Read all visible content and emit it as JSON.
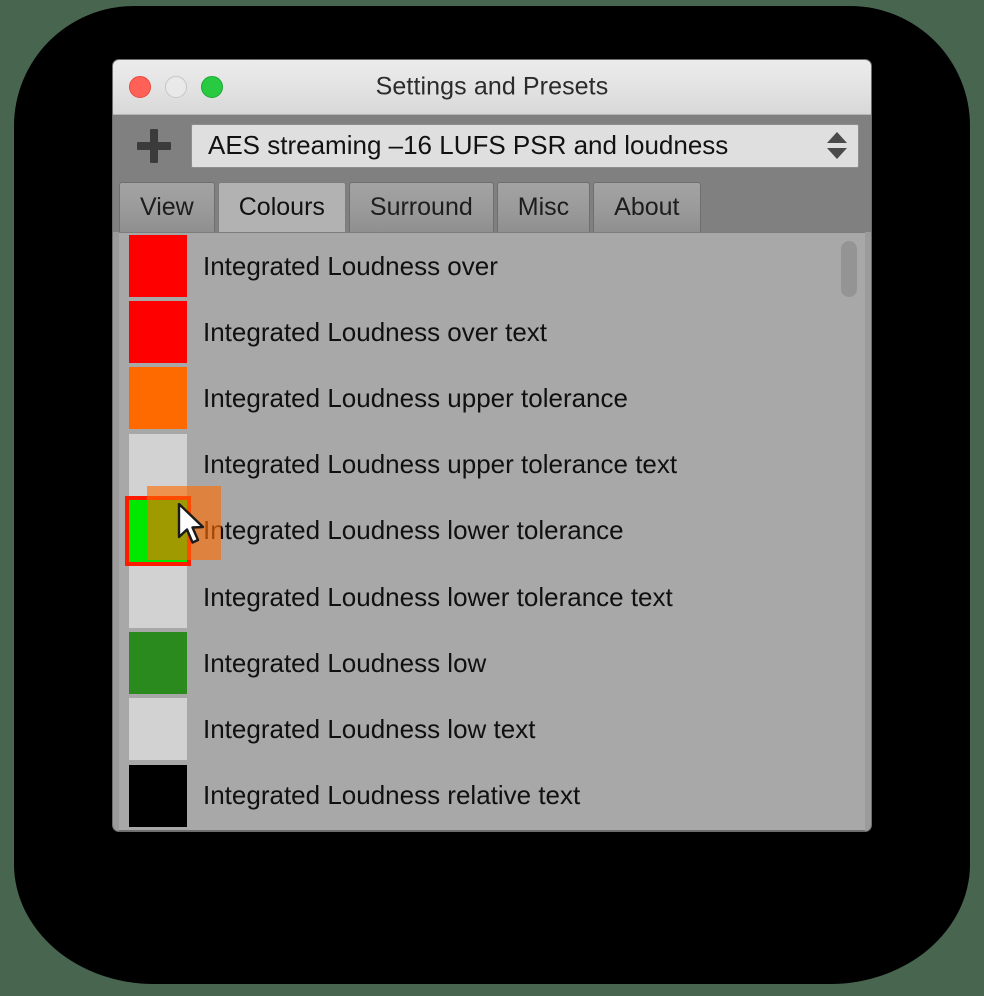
{
  "window": {
    "title": "Settings and Presets",
    "traffic_lights": [
      {
        "name": "close",
        "color": "#ff6157"
      },
      {
        "name": "minimize",
        "color": "#e9e9e9"
      },
      {
        "name": "zoom",
        "color": "#27ca41"
      }
    ]
  },
  "toolbar": {
    "add_preset_icon": "plus-icon",
    "preset": {
      "value": "AES streaming –16 LUFS PSR and loudness",
      "stepper_up_icon": "triangle-up-icon",
      "stepper_down_icon": "triangle-down-icon"
    }
  },
  "tabs": [
    {
      "label": "View",
      "active": false
    },
    {
      "label": "Colours",
      "active": true
    },
    {
      "label": "Surround",
      "active": false
    },
    {
      "label": "Misc",
      "active": false
    },
    {
      "label": "About",
      "active": false
    }
  ],
  "colour_list": {
    "rows": [
      {
        "label": "Integrated Loudness over",
        "swatch": "#ff0000",
        "state": "normal"
      },
      {
        "label": "Integrated Loudness over text",
        "swatch": "#ff0000",
        "state": "normal"
      },
      {
        "label": "Integrated Loudness upper tolerance",
        "swatch": "#ff6a00",
        "state": "normal"
      },
      {
        "label": "Integrated Loudness upper tolerance text",
        "swatch": "#d2d2d2",
        "state": "normal"
      },
      {
        "label": "Integrated Loudness lower tolerance",
        "swatch": "#00e800",
        "state": "dragging"
      },
      {
        "label": "Integrated Loudness lower tolerance text",
        "swatch": "#d2d2d2",
        "state": "normal"
      },
      {
        "label": "Integrated Loudness low",
        "swatch": "#2a8a1e",
        "state": "normal"
      },
      {
        "label": "Integrated Loudness low text",
        "swatch": "#d2d2d2",
        "state": "normal"
      },
      {
        "label": "Integrated Loudness relative text",
        "swatch": "#000000",
        "state": "normal"
      }
    ],
    "drag": {
      "ghost_color": "#ff6a00",
      "selection_border_color": "#ff1a00",
      "cursor_icon": "arrow-pointer-cursor"
    },
    "scrollbar": {
      "thumb_color": "#949494",
      "orientation": "vertical"
    }
  },
  "theme": {
    "desktop_background": "#47654f",
    "window_chrome": "#808080",
    "list_background": "#a8a8a8",
    "titlebar_background": "#e6e6e6"
  }
}
